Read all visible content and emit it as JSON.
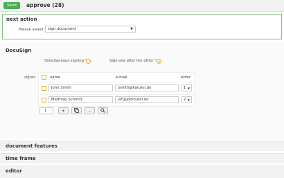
{
  "header": {
    "send_label": "Send",
    "title": "approve (28)"
  },
  "next_action": {
    "title": "next action",
    "select_label": "Please select:",
    "required_mark": "*",
    "selected_value": "sign document"
  },
  "docusign": {
    "title": "DocuSign",
    "options": [
      {
        "label": "Simultaneous signing",
        "selected": false
      },
      {
        "label": "Sign one after the other",
        "selected": true
      }
    ],
    "signer_label": "signer",
    "columns": {
      "name": "name",
      "email": "e-mail",
      "order": "order"
    },
    "rows": [
      {
        "name": "John Smith",
        "email": "jsmith@kanzlei.de",
        "order": "1"
      },
      {
        "name": "Matthias Schmitt",
        "email": "GF@jobrouter.de",
        "order": "2"
      }
    ],
    "count": "1"
  },
  "sections": [
    "document features",
    "time frame",
    "editor"
  ],
  "colors": {
    "accent": "#4caf50",
    "required": "#e53935",
    "radio": "#e6a817"
  }
}
